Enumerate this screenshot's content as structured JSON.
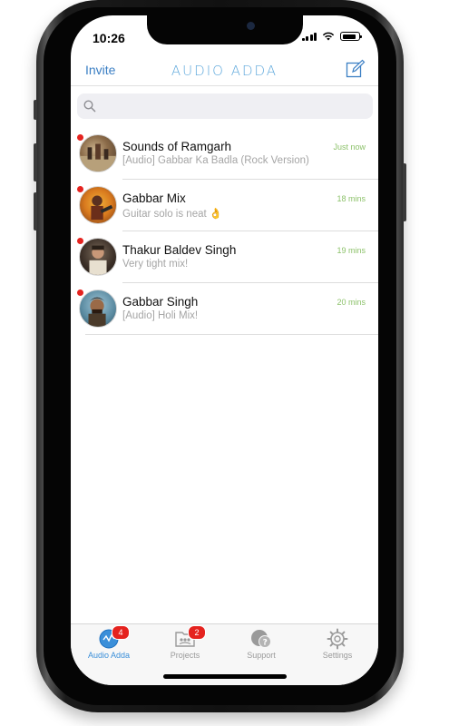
{
  "status": {
    "time": "10:26"
  },
  "navbar": {
    "invite_label": "Invite",
    "title": "AUDIO ADDA",
    "compose_icon": "compose-icon"
  },
  "search": {
    "placeholder": "",
    "value": ""
  },
  "chats": [
    {
      "name": "Sounds of Ramgarh",
      "time": "Just now",
      "preview": "[Audio] Gabbar Ka Badla (Rock Version)",
      "unread": true
    },
    {
      "name": "Gabbar Mix",
      "time": "18 mins",
      "preview": "Guitar solo is neat 👌",
      "unread": true
    },
    {
      "name": "Thakur Baldev Singh",
      "time": "19 mins",
      "preview": "Very tight mix!",
      "unread": true
    },
    {
      "name": "Gabbar Singh",
      "time": "20 mins",
      "preview": "[Audio] Holi Mix!",
      "unread": true
    }
  ],
  "tabs": [
    {
      "label": "Audio Adda",
      "icon": "audio-adda-icon",
      "badge": "4",
      "active": true
    },
    {
      "label": "Projects",
      "icon": "projects-icon",
      "badge": "2",
      "active": false
    },
    {
      "label": "Support",
      "icon": "support-icon",
      "badge": "",
      "active": false
    },
    {
      "label": "Settings",
      "icon": "settings-icon",
      "badge": "",
      "active": false
    }
  ],
  "colors": {
    "accent": "#3b7fc4",
    "title": "#5ea8dc",
    "time_green": "#8dc26b",
    "badge_red": "#e5231f"
  }
}
